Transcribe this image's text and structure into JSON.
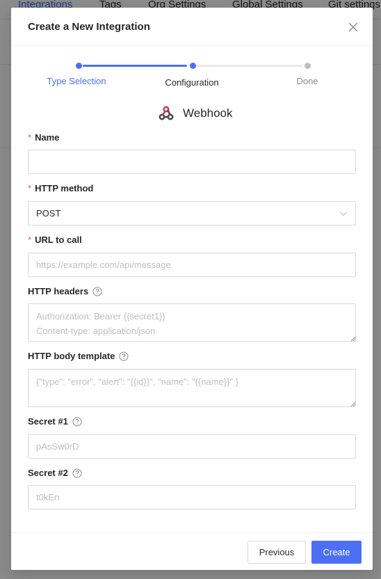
{
  "background": {
    "tabs": [
      {
        "label": "Integrations"
      },
      {
        "label": "Tags"
      },
      {
        "label": "Org Settings"
      },
      {
        "label": "Global Settings"
      },
      {
        "label": "Git settings"
      }
    ]
  },
  "modal": {
    "title": "Create a New Integration",
    "close_icon": "close-icon"
  },
  "steps": [
    {
      "label": "Type Selection",
      "state": "done"
    },
    {
      "label": "Configuration",
      "state": "current"
    },
    {
      "label": "Done",
      "state": "pending"
    }
  ],
  "integration": {
    "icon": "webhook-icon",
    "name": "Webhook"
  },
  "form": {
    "name": {
      "label": "Name",
      "required": true,
      "value": "",
      "placeholder": ""
    },
    "http_method": {
      "label": "HTTP method",
      "required": true,
      "value": "POST"
    },
    "url": {
      "label": "URL to call",
      "required": true,
      "value": "",
      "placeholder": "https://example.com/api/message"
    },
    "headers": {
      "label": "HTTP headers",
      "value": "",
      "placeholder": "Authorization: Bearer {{secret1}}\nContent-type: application/json"
    },
    "body_template": {
      "label": "HTTP body template",
      "value": "",
      "placeholder": "{\"type\": \"error\", \"alert\": \"{{id}}\", \"name\": \"{{name}}\" }"
    },
    "secret1": {
      "label": "Secret #1",
      "value": "",
      "placeholder": "pAsSw0rD"
    },
    "secret2": {
      "label": "Secret #2",
      "value": "",
      "placeholder": "t0kEn"
    }
  },
  "footer": {
    "previous_label": "Previous",
    "create_label": "Create"
  },
  "colors": {
    "accent": "#4d6ff5",
    "required": "#ff4d4f",
    "pending": "#bfbfbf"
  }
}
